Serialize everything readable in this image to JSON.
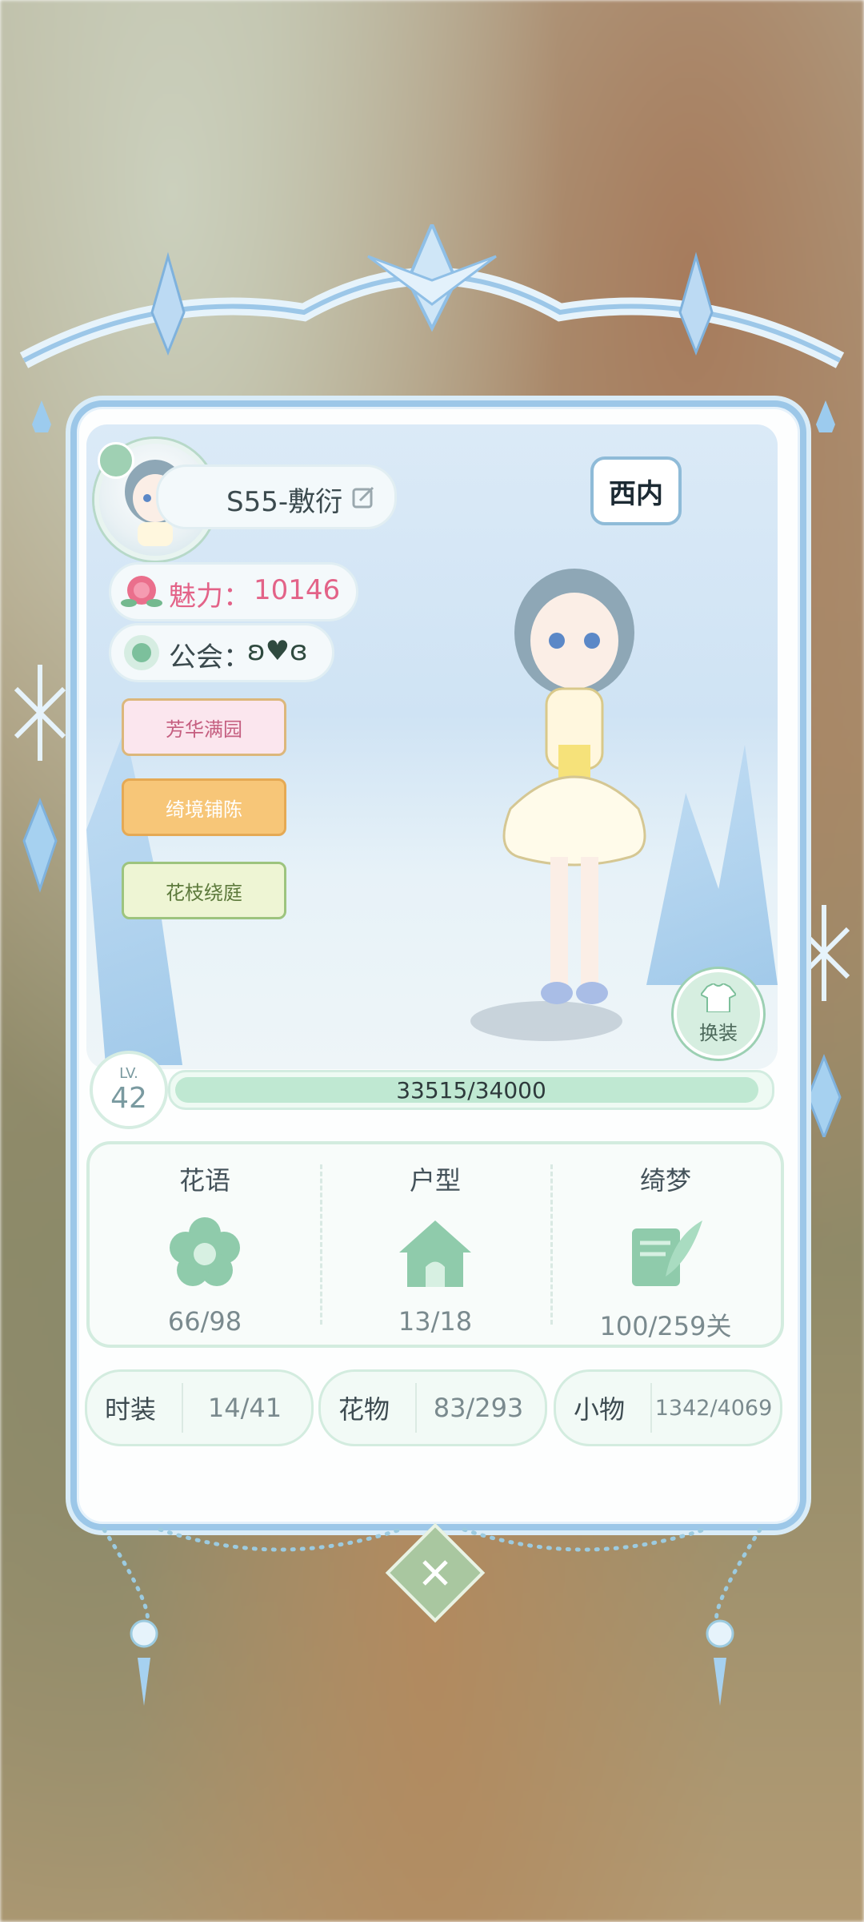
{
  "profile": {
    "name": "S55-敷衍",
    "region": "西内",
    "charm_label": "魅力：",
    "charm_value": "10146",
    "guild_label": "公会：",
    "guild_value": "ʚ♥ɞ",
    "edit_icon": "edit-icon"
  },
  "tags": [
    {
      "label": "芳华满园"
    },
    {
      "label": "绮境铺陈"
    },
    {
      "label": "花枝绕庭"
    }
  ],
  "change_button": {
    "label": "换装"
  },
  "level": {
    "prefix": "LV.",
    "value": "42",
    "xp_text": "33515/34000",
    "xp_fraction": 0.9857
  },
  "stats": [
    {
      "label": "花语",
      "value": "66/98",
      "icon": "flower-icon"
    },
    {
      "label": "户型",
      "value": "13/18",
      "icon": "house-icon"
    },
    {
      "label": "绮梦",
      "value": "100/259关",
      "icon": "letter-quill-icon"
    }
  ],
  "collections": [
    {
      "label": "时装",
      "value": "14/41"
    },
    {
      "label": "花物",
      "value": "83/293"
    },
    {
      "label": "小物",
      "value": "1342/4069"
    }
  ],
  "close_icon": "close-icon"
}
